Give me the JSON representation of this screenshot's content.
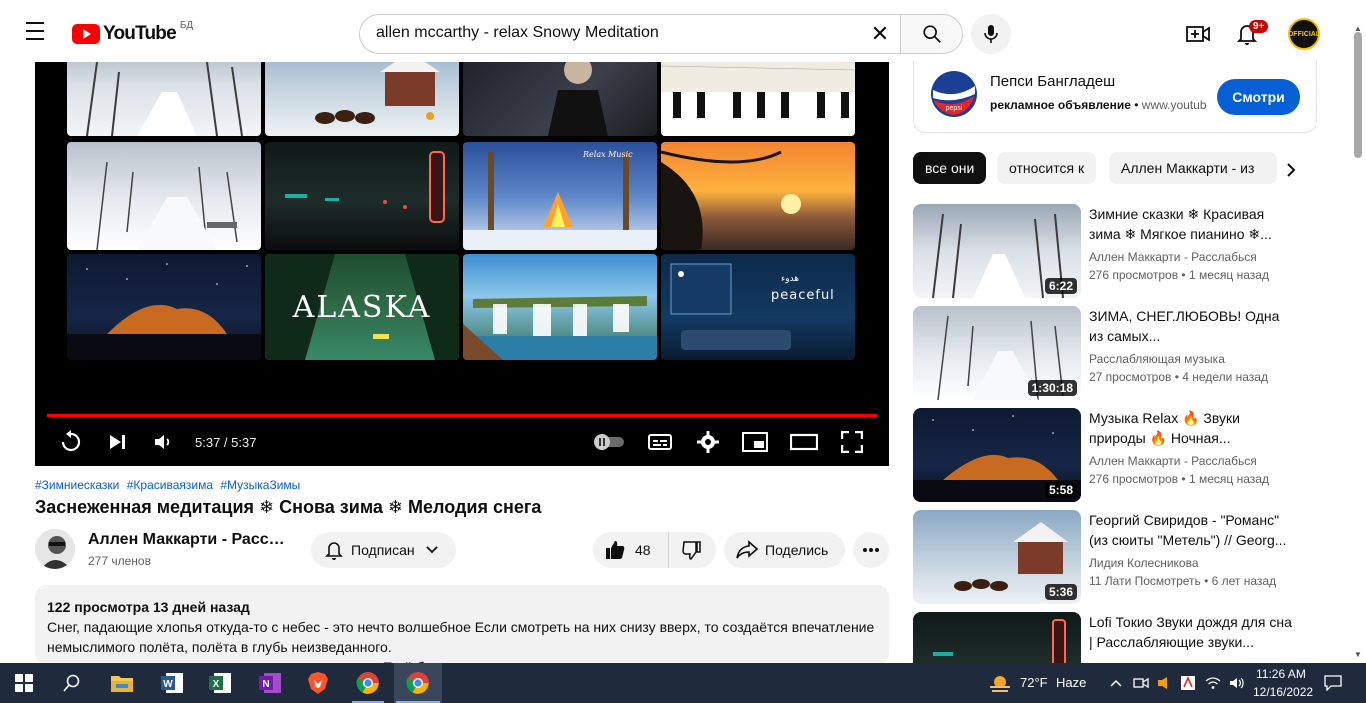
{
  "masthead": {
    "logo_text": "YouTube",
    "region": "БД",
    "search_value": "allen mccarthy - relax Snowy Meditation",
    "notification_count": "9+",
    "avatar_text": "OFFICIAL",
    "icons": [
      "menu-icon",
      "youtube-logo",
      "clear-icon",
      "search-icon",
      "mic-icon",
      "create-icon",
      "bell-icon"
    ]
  },
  "player": {
    "tiles": [
      {
        "label": ""
      },
      {
        "label": ""
      },
      {
        "label": ""
      },
      {
        "label": ""
      },
      {
        "label": ""
      },
      {
        "label": ""
      },
      {
        "label": "Relax Music"
      },
      {
        "label": ""
      },
      {
        "label": ""
      },
      {
        "label": "ALASKA"
      },
      {
        "label": ""
      },
      {
        "label": "peaceful"
      }
    ],
    "tile_caption_small": "هدوء",
    "time": "5:37 / 5:37",
    "progress": 1.0,
    "controls": [
      "replay-icon",
      "next-icon",
      "volume-icon",
      "autoplay-toggle",
      "subtitles-icon",
      "settings-icon",
      "miniplayer-icon",
      "theater-icon",
      "fullscreen-icon"
    ]
  },
  "video": {
    "hashtags": [
      "#Зимниесказки",
      "#Красиваязима",
      "#МузыкаЗимы"
    ],
    "title": "Заснеженная медитация ❄ Снова зима ❄ Мелодия снега",
    "channel_name": "Аллен Маккарти - Расслабься",
    "subscribers": "277 членов",
    "subscribe_label": "Подписан",
    "likes": "48",
    "share_label": "Поделись",
    "description_meta": "122 просмотра 13 дней назад",
    "description_text": "Снег, падающие хлопья откуда-то с небес - это нечто волшебное Если смотреть на них снизу вверх, то создаётся впечатление немыслимого полёта, полёта в глубь неизведанного.",
    "show_more": "Ещё больше"
  },
  "ad": {
    "title": "Пепси Бангладеш",
    "label": "рекламное объявление",
    "url": "www.youtube.com",
    "button": "Смотри"
  },
  "chips": [
    "все они",
    "относится к",
    "Аллен Маккарти - из"
  ],
  "recommendations": [
    {
      "title": "Зимние сказки ❄ Красивая зима ❄ Мягкое пианино ❄...",
      "channel": "Аллен Маккарти - Расслабься",
      "views": "276 просмотров",
      "age": "1 месяц назад",
      "duration": "6:22"
    },
    {
      "title": "ЗИМА, СНЕГ.ЛЮБОВЬ! Одна из самых...",
      "channel": "Расслабляющая музыка",
      "views": "27 просмотров",
      "age": "4 недели назад",
      "duration": "1:30:18"
    },
    {
      "title": "Музыка Relax 🔥 Звуки природы 🔥 Ночная...",
      "channel": "Аллен Маккарти - Расслабься",
      "views": "276 просмотров",
      "age": "1 месяц назад",
      "duration": "5:58"
    },
    {
      "title": "Георгий Свиридов - \"Романс\" (из сюиты \"Метель\") // Georg...",
      "channel": "Лидия Колесникова",
      "views": "11 Лати Посмотреть",
      "age": "6 лет назад",
      "duration": "5:36"
    },
    {
      "title": "Lofi Токио Звуки дождя для сна | Расслабляющие звуки...",
      "channel": "",
      "views": "",
      "age": "",
      "duration": ""
    }
  ],
  "taskbar": {
    "apps": [
      "start-icon",
      "search-icon",
      "file-explorer-icon",
      "word-icon",
      "excel-icon",
      "onenote-icon",
      "brave-icon",
      "chrome-icon",
      "chrome-active-icon"
    ],
    "temperature": "72°F",
    "condition": "Haze",
    "time": "11:26 AM",
    "date": "12/16/2022"
  }
}
